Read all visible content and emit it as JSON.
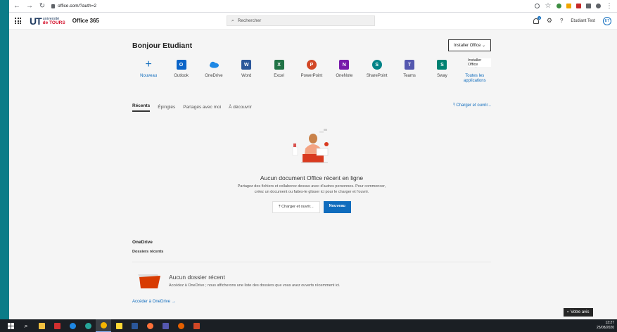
{
  "browser": {
    "url": "office.com/?auth=2"
  },
  "header": {
    "logo_mark": "UT",
    "logo_line1": "université",
    "logo_line2": "de TOURS",
    "app_name": "Office 365",
    "search_placeholder": "Rechercher",
    "notif_count": "1",
    "user_name": "Etudiant Test",
    "user_initials": "ET"
  },
  "main": {
    "greeting": "Bonjour Etudiant",
    "install_button": "Installer Office",
    "tooltip": "Installer Office",
    "apps": [
      {
        "label": "Nouveau",
        "icon": "plus-icon",
        "color": "#0f6cbd"
      },
      {
        "label": "Outlook",
        "icon": "outlook-icon",
        "color": "#0a64c8"
      },
      {
        "label": "OneDrive",
        "icon": "onedrive-icon",
        "color": "#1e88e5"
      },
      {
        "label": "Word",
        "icon": "word-icon",
        "color": "#2b579a"
      },
      {
        "label": "Excel",
        "icon": "excel-icon",
        "color": "#217346"
      },
      {
        "label": "PowerPoint",
        "icon": "powerpoint-icon",
        "color": "#d24726"
      },
      {
        "label": "OneNote",
        "icon": "onenote-icon",
        "color": "#7719aa"
      },
      {
        "label": "SharePoint",
        "icon": "sharepoint-icon",
        "color": "#038387"
      },
      {
        "label": "Teams",
        "icon": "teams-icon",
        "color": "#5558af"
      },
      {
        "label": "Sway",
        "icon": "sway-icon",
        "color": "#008272"
      },
      {
        "label": "Toutes les applications",
        "icon": "arrow-right-icon",
        "color": "#0f6cbd"
      }
    ],
    "tabs": [
      "Récents",
      "Épinglés",
      "Partagés avec moi",
      "À découvrir"
    ],
    "upload_link": "Charger et ouvrir...",
    "empty_title": "Aucun document Office récent en ligne",
    "empty_desc_1": "Partagez des fichiers et collaborez dessus avec d'autres personnes. Pour commencer,",
    "empty_desc_2": "créez un document ou faites-le glisser ici pour le charger et l'ouvrir.",
    "upload_button": "Charger et ouvrir...",
    "new_button": "Nouveau"
  },
  "onedrive": {
    "title": "OneDrive",
    "subtitle": "Dossiers récents",
    "no_folder_title": "Aucun dossier récent",
    "no_folder_desc": "Accédez à OneDrive ; nous afficherons une liste des dossiers que vous avez ouverts récemment ici.",
    "link": "Accéder à OneDrive"
  },
  "feedback_button": "Votre avis",
  "taskbar": {
    "time": "13:27",
    "date": "25/08/2020"
  }
}
